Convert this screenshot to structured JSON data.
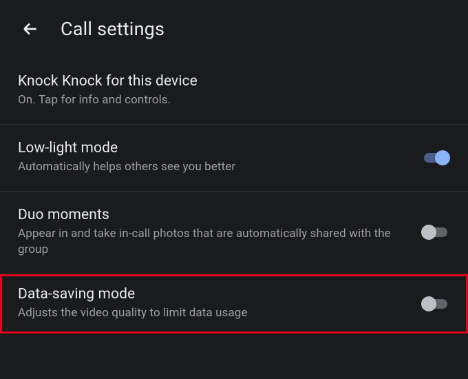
{
  "header": {
    "title": "Call settings"
  },
  "settings": {
    "knockKnock": {
      "title": "Knock Knock for this device",
      "subtitle": "On. Tap for info and controls."
    },
    "lowLight": {
      "title": "Low-light mode",
      "subtitle": "Automatically helps others see you better"
    },
    "duoMoments": {
      "title": "Duo moments",
      "subtitle": "Appear in and take in-call photos that are automatically shared with the group"
    },
    "dataSaving": {
      "title": "Data-saving mode",
      "subtitle": "Adjusts the video quality to limit data usage"
    }
  }
}
